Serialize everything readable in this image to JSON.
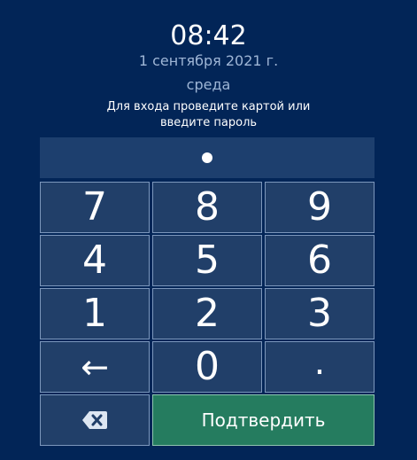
{
  "header": {
    "time": "08:42",
    "date": "1 сентября 2021 г.",
    "weekday": "среда",
    "instruction_line1": "Для входа проведите картой или",
    "instruction_line2": "введите пароль"
  },
  "pin": {
    "entered_count": 1
  },
  "keypad": {
    "row1": [
      "7",
      "8",
      "9"
    ],
    "row2": [
      "4",
      "5",
      "6"
    ],
    "row3": [
      "1",
      "2",
      "3"
    ],
    "back_arrow": "←",
    "zero": "0",
    "dot": ".",
    "backspace_icon": "backspace-icon",
    "confirm_label": "Подтвердить"
  },
  "colors": {
    "background": "#022557",
    "key": "#213f69",
    "key_border": "#7d97bc",
    "confirm": "#257c5f",
    "secondary_text": "#9fb6d6"
  }
}
